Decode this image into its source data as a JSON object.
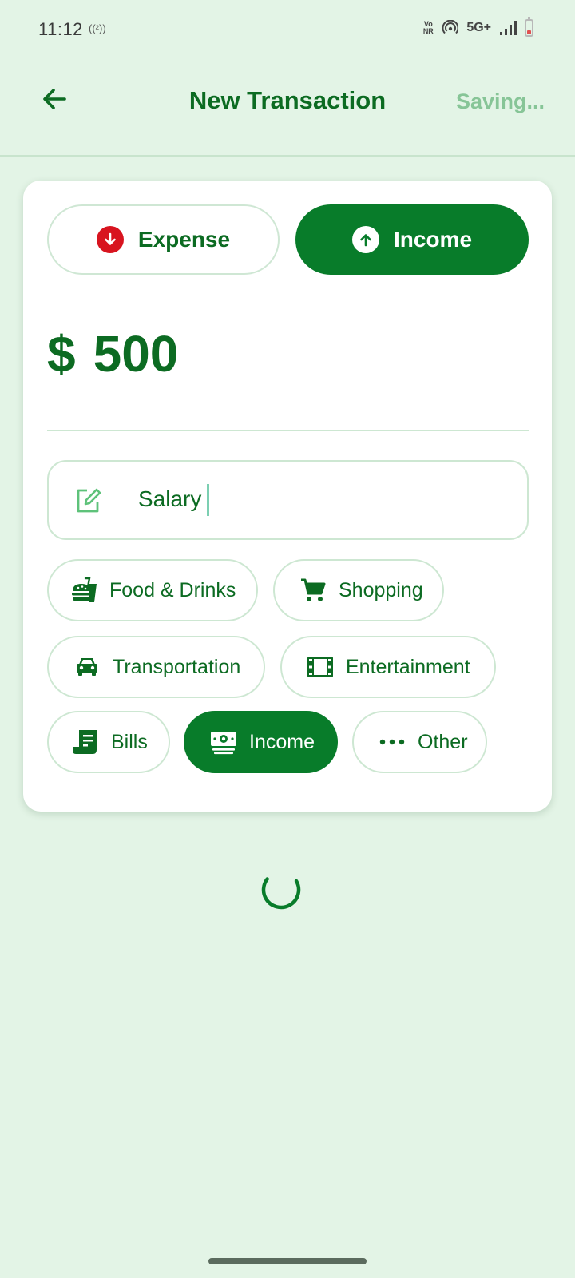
{
  "status_bar": {
    "time": "11:12",
    "hotspot_label": "((²))",
    "volte_top": "Vo",
    "volte_bottom": "NR",
    "network": "5G+"
  },
  "app_bar": {
    "title": "New Transaction",
    "saving_label": "Saving..."
  },
  "transaction_type": {
    "expense_label": "Expense",
    "income_label": "Income",
    "selected": "Income"
  },
  "amount": {
    "currency": "$",
    "value": "500"
  },
  "note": {
    "value": "Salary"
  },
  "categories": [
    {
      "label": "Food & Drinks",
      "icon": "food-drinks-icon"
    },
    {
      "label": "Shopping",
      "icon": "shopping-cart-icon"
    },
    {
      "label": "Transportation",
      "icon": "car-icon"
    },
    {
      "label": "Entertainment",
      "icon": "film-icon"
    },
    {
      "label": "Bills",
      "icon": "receipt-icon"
    },
    {
      "label": "Income",
      "icon": "money-icon",
      "selected": true
    },
    {
      "label": "Other",
      "icon": "more-dots-icon"
    }
  ],
  "colors": {
    "primary": "#087c2a",
    "text": "#0c6b22",
    "background": "#e3f4e6",
    "expense_accent": "#d8141f",
    "saving_text": "#87c597"
  }
}
